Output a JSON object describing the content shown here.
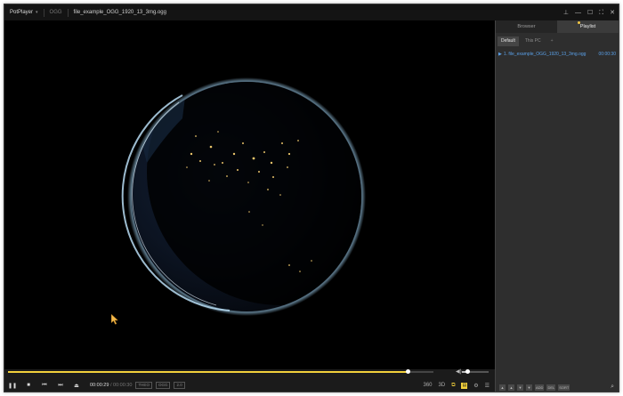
{
  "window": {
    "app_name": "PotPlayer",
    "format": "OGG",
    "file_title": "file_example_OGG_1920_13_3mg.ogg",
    "controls": {
      "pin": "⊥",
      "minimize": "—",
      "maximize": "☐",
      "fullscreen": "⛶",
      "close": "✕"
    }
  },
  "sidepanel": {
    "tabs": [
      {
        "label": "Browser"
      },
      {
        "label": "Playlist"
      }
    ],
    "subtabs": [
      {
        "label": "Default"
      },
      {
        "label": "This PC"
      },
      {
        "label": "+"
      }
    ],
    "playlist": [
      {
        "label": "1. file_example_OGG_1920_13_3mg.ogg",
        "duration": "00:00:30"
      }
    ],
    "bottom_buttons": [
      "▲",
      "▲",
      "▼",
      "▼",
      "ADD",
      "DEL",
      "SORT"
    ]
  },
  "controls": {
    "seek_progress": 0.94,
    "volume_level": 0.2,
    "current_time": "00:00:29",
    "time_separator": "/",
    "total_time": "00:00:30",
    "video_codec": "THEO",
    "audio_codec": "OGG",
    "channels": "2.0",
    "right_labels": {
      "a": "360",
      "b": "3D"
    }
  },
  "colors": {
    "accent": "#f2d03b",
    "playlist_link": "#5aa0e8"
  }
}
